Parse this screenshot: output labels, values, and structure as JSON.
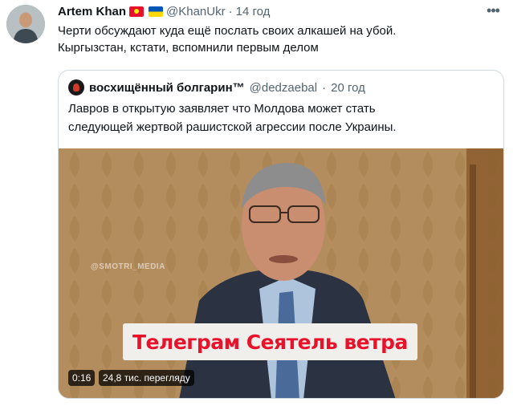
{
  "tweet": {
    "author_name": "Artem Khan",
    "handle": "@KhanUkr",
    "separator": "·",
    "time": "14 год",
    "more_icon": "ellipsis-icon",
    "flags": [
      "kyrgyzstan-flag-icon",
      "ukraine-flag-icon"
    ],
    "text_lines": [
      "Черти обсуждают куда ещё послать своих алкашей на убой.",
      "Кыргызстан, кстати, вспомнили первым делом"
    ]
  },
  "quoted": {
    "author_name": "восхищённый болгарин™",
    "handle": "@dedzaebal",
    "separator": "·",
    "time": "20 год",
    "text_lines": [
      "Лавров в открытую заявляет что Молдова может стать",
      "следующей жертвой рашистской агрессии после Украины."
    ],
    "video": {
      "watermark": "@SMOTRI_MEDIA",
      "caption": "Телеграм Сеятель ветра",
      "duration": "0:16",
      "views": "24,8 тис. перегляду"
    }
  },
  "colors": {
    "text": "#0f1419",
    "secondary": "#536471",
    "border": "#cfd9de",
    "caption_red": "#e8122a"
  }
}
